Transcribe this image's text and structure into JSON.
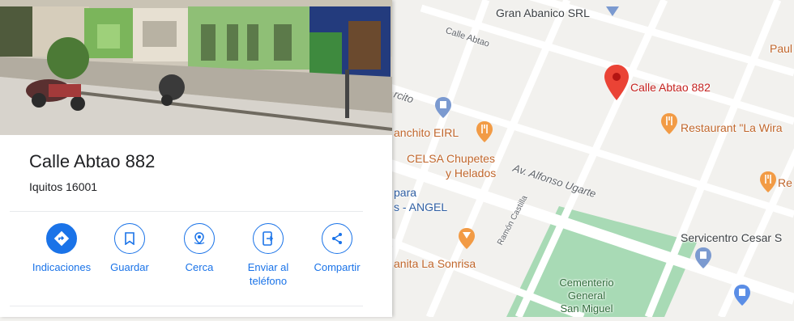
{
  "place": {
    "name": "Calle Abtao 882",
    "address": "Iquitos 16001"
  },
  "actions": [
    {
      "id": "directions",
      "label": "Indicaciones",
      "icon": "directions-icon",
      "primary": true
    },
    {
      "id": "save",
      "label": "Guardar",
      "icon": "bookmark-icon",
      "primary": false
    },
    {
      "id": "nearby",
      "label": "Cerca",
      "icon": "nearby-icon",
      "primary": false
    },
    {
      "id": "send",
      "label": "Enviar al teléfono",
      "icon": "send-to-phone-icon",
      "primary": false
    },
    {
      "id": "share",
      "label": "Compartir",
      "icon": "share-icon",
      "primary": false
    }
  ],
  "map": {
    "pin_label": "Calle Abtao 882",
    "labels": {
      "gran_abanico": "Gran Abanico SRL",
      "paul": "Paul",
      "calle_abtao": "Calle Abtao",
      "circuito": "rcito",
      "anchito": "anchito EIRL",
      "restaurant_wira": "Restaurant \"La Wira",
      "celsa_1": "CELSA Chupetes",
      "celsa_2": "y Helados",
      "av_alfonso": "Av. Alfonso Ugarte",
      "re": "Re",
      "para": "para",
      "angel": "s - ANGEL",
      "ramon": "Ramón Castilla",
      "servicentro": "Servicentro Cesar S",
      "sonrisa": "anita La Sonrisa",
      "cementerio_1": "Cementerio",
      "cementerio_2": "General",
      "cementerio_3": "San Miguel"
    }
  },
  "colors": {
    "accent": "#1a73e8",
    "pin": "#ea4335",
    "poi_orange": "#f29b45",
    "poi_blue": "#7b9ad0",
    "park": "#a8dab5"
  }
}
